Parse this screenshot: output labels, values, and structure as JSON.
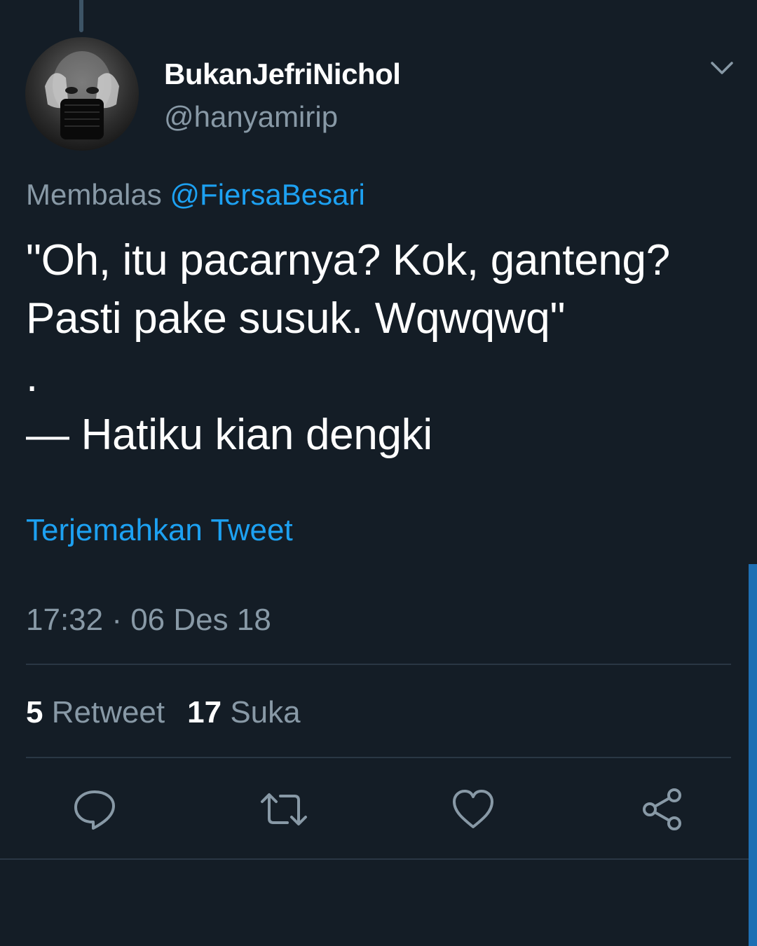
{
  "tweet": {
    "display_name": "BukanJefriNichol",
    "handle": "@hanyamirip",
    "reply_prefix": "Membalas",
    "reply_mention": "@FiersaBesari",
    "text": "\"Oh, itu pacarnya? Kok, ganteng?\nPasti pake susuk. Wqwqwq\"\n.\n— Hatiku kian dengki",
    "translate_label": "Terjemahkan Tweet",
    "timestamp": "17:32 · 06 Des 18"
  },
  "stats": {
    "retweet_count": "5",
    "retweet_label": "Retweet",
    "like_count": "17",
    "like_label": "Suka"
  },
  "icons": {
    "menu": "chevron-down-icon",
    "reply": "reply-icon",
    "retweet": "retweet-icon",
    "like": "heart-icon",
    "share": "share-icon"
  },
  "colors": {
    "background": "#141d26",
    "accent": "#1da1f2",
    "secondary_text": "#8899a6",
    "icon": "#8899a6"
  }
}
